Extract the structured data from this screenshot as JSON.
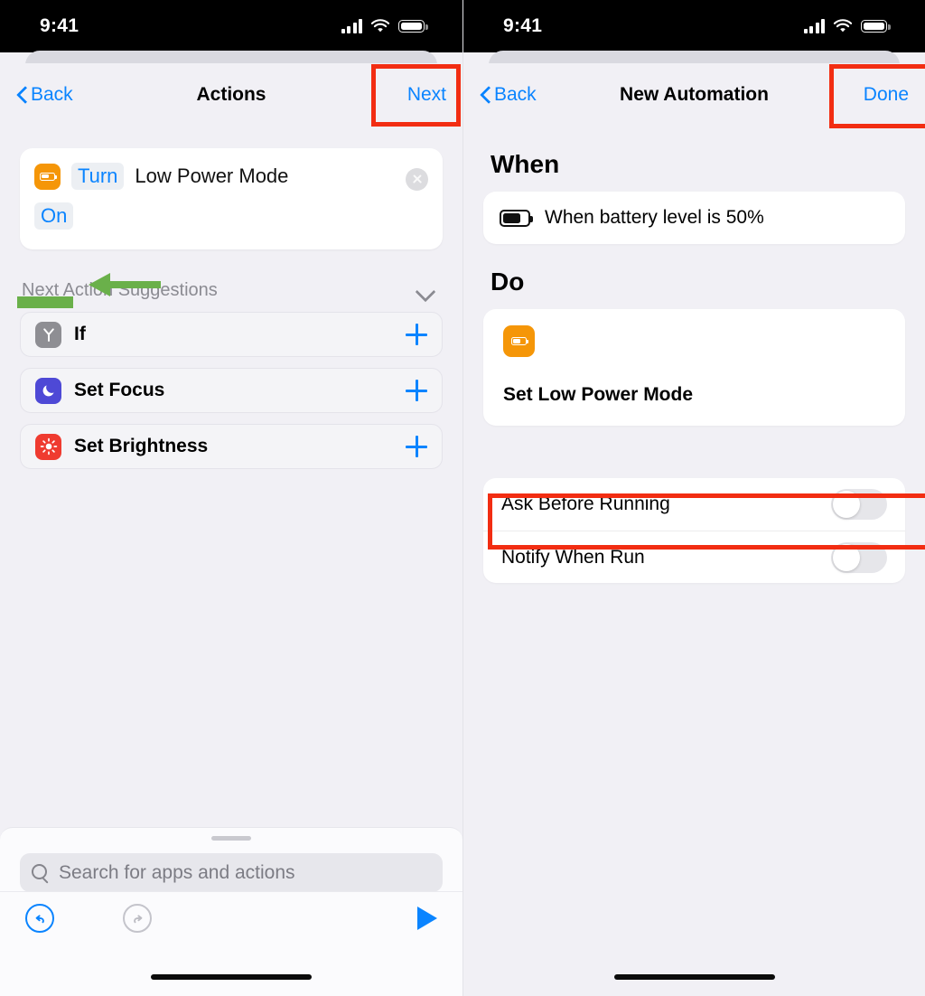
{
  "status_bar": {
    "time": "9:41",
    "cellular_icon": "signal-bars-icon",
    "wifi_icon": "wifi-icon",
    "battery_icon": "battery-icon"
  },
  "colors": {
    "accent_blue": "#0a84ff",
    "annotation_red": "#f22d12",
    "annotation_green": "#6ab04a",
    "shortcut_orange": "#f59608",
    "background": "#f1f0f5"
  },
  "left_screen": {
    "nav": {
      "back_label": "Back",
      "title": "Actions",
      "action_label": "Next"
    },
    "action_card": {
      "icon": "low-power-mode-icon",
      "verb_chip": "Turn",
      "action_text": "Low Power Mode",
      "value_chip": "On",
      "close_icon": "close-icon"
    },
    "suggestions": {
      "header": "Next Action Suggestions",
      "collapse_icon": "chevron-down-icon",
      "items": [
        {
          "label": "If",
          "icon": "branch-icon",
          "icon_color": "#8e8e93",
          "add_icon": "plus-icon"
        },
        {
          "label": "Set Focus",
          "icon": "moon-icon",
          "icon_color": "#4e49d6",
          "add_icon": "plus-icon"
        },
        {
          "label": "Set Brightness",
          "icon": "brightness-icon",
          "icon_color": "#ef3b30",
          "add_icon": "plus-icon"
        }
      ]
    },
    "drawer": {
      "search_placeholder": "Search for apps and actions",
      "search_value": "",
      "search_icon": "search-icon"
    },
    "toolbar": {
      "undo_icon": "undo-icon",
      "redo_icon": "redo-icon",
      "play_icon": "play-icon"
    }
  },
  "right_screen": {
    "nav": {
      "back_label": "Back",
      "title": "New Automation",
      "action_label": "Done"
    },
    "when": {
      "heading": "When",
      "trigger_icon": "battery-level-icon",
      "trigger_text": "When battery level is 50%"
    },
    "do": {
      "heading": "Do",
      "action_icon": "low-power-mode-icon",
      "action_label": "Set Low Power Mode"
    },
    "options": [
      {
        "label": "Ask Before Running",
        "state": "off"
      },
      {
        "label": "Notify When Run",
        "state": "off"
      }
    ]
  },
  "annotations": {
    "next_highlight": "red-box-next",
    "done_highlight": "red-box-done",
    "ask_highlight": "red-box-ask-before-running",
    "on_arrow": "green-arrow-pointing-to-on",
    "on_underline": "green-underline-under-on"
  }
}
